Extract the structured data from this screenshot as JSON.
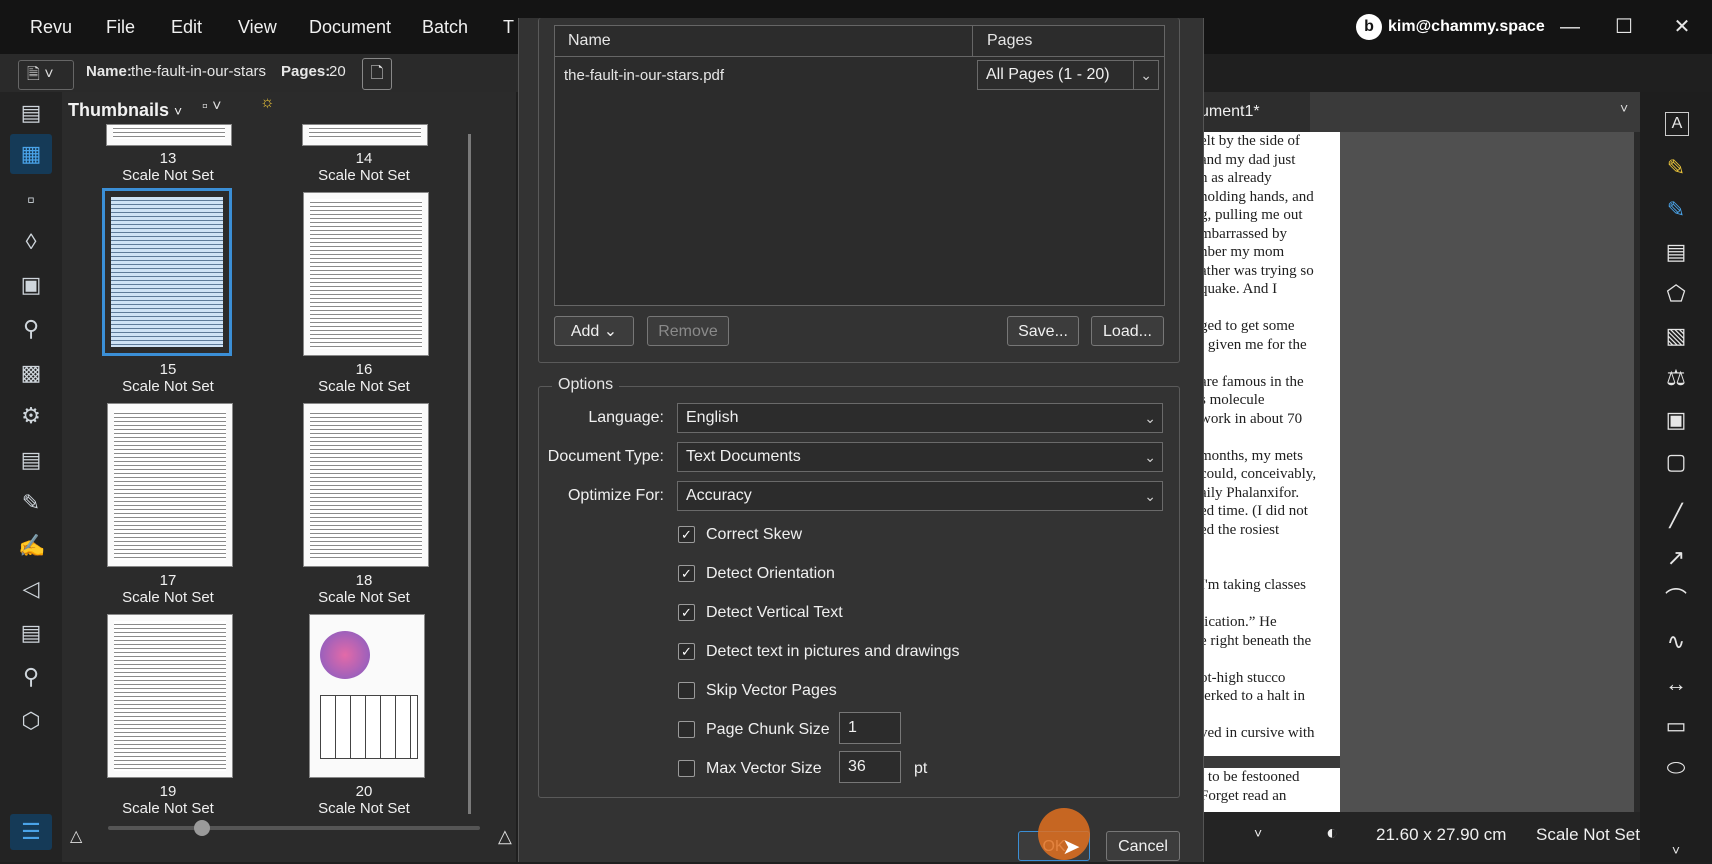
{
  "menu": {
    "app": "Revu",
    "items": [
      "File",
      "Edit",
      "View",
      "Document",
      "Batch",
      "T"
    ]
  },
  "user": {
    "email": "kim@chammy.space"
  },
  "props": {
    "name_label": "Name:",
    "name_value": "the-fault-in-our-stars",
    "pages_label": "Pages:",
    "pages_value": "20"
  },
  "thumbnails": {
    "header": "Thumbnails",
    "items": [
      {
        "num": "13",
        "scale": "Scale Not Set"
      },
      {
        "num": "14",
        "scale": "Scale Not Set"
      },
      {
        "num": "15",
        "scale": "Scale Not Set"
      },
      {
        "num": "16",
        "scale": "Scale Not Set"
      },
      {
        "num": "17",
        "scale": "Scale Not Set"
      },
      {
        "num": "18",
        "scale": "Scale Not Set"
      },
      {
        "num": "19",
        "scale": "Scale Not Set"
      },
      {
        "num": "20",
        "scale": "Scale Not Set"
      }
    ]
  },
  "doc": {
    "tab": "ument1*",
    "lines": [
      "elt by the side of",
      "and my dad just",
      "n as already",
      "holding hands, and",
      "g, pulling me out",
      "mbarrassed by",
      "nber my mom",
      "ather was trying so",
      "quake. And I",
      "",
      "ged to get some",
      "l given me for the",
      "",
      "are famous in the",
      "s molecule",
      "work in about 70",
      "",
      "months, my mets",
      "could, conceivably,",
      "aily Phalanxifor.",
      "ed time. (I did not",
      "ed the rosiest",
      "",
      "",
      "I'm taking classes",
      "",
      "tication.” He",
      "e right beneath the",
      "",
      "ot-high stucco",
      "jerked to a halt in",
      "",
      "ved in cursive with"
    ],
    "lines2": [
      "t to be festooned",
      "Forget read an"
    ]
  },
  "status": {
    "size": "21.60 x 27.90 cm",
    "scale": "Scale Not Set"
  },
  "dialog": {
    "table": {
      "col_name": "Name",
      "col_pages": "Pages",
      "file": "the-fault-in-our-stars.pdf",
      "pages_value": "All Pages (1 - 20)"
    },
    "buttons": {
      "add": "Add",
      "remove": "Remove",
      "save": "Save...",
      "load": "Load...",
      "ok": "OK",
      "cancel": "Cancel"
    },
    "options": {
      "title": "Options",
      "language_label": "Language:",
      "language": "English",
      "doctype_label": "Document Type:",
      "doctype": "Text Documents",
      "optimize_label": "Optimize For:",
      "optimize": "Accuracy",
      "checks": [
        {
          "label": "Correct Skew",
          "checked": true
        },
        {
          "label": "Detect Orientation",
          "checked": true
        },
        {
          "label": "Detect Vertical Text",
          "checked": true
        },
        {
          "label": "Detect text in pictures and drawings",
          "checked": true
        },
        {
          "label": "Skip Vector Pages",
          "checked": false
        },
        {
          "label": "Page Chunk Size",
          "checked": false
        },
        {
          "label": "Max Vector Size",
          "checked": false
        }
      ],
      "chunk_size": "1",
      "vector_size": "36",
      "vector_unit": "pt"
    }
  },
  "colors": {
    "accent": "#3b8fd6",
    "ok_cursor": "#e07020"
  }
}
